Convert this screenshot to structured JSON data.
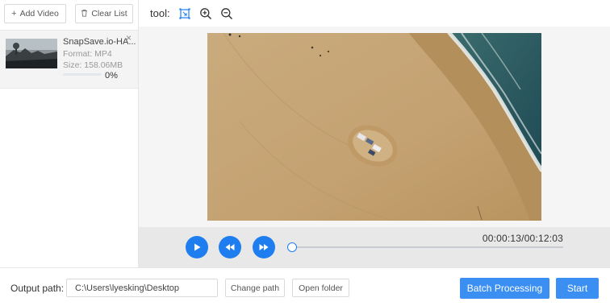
{
  "left_panel": {
    "add_video_label": "Add Video",
    "clear_list_label": "Clear List",
    "file": {
      "name": "SnapSave.io-HA...",
      "format": "Format:  MP4",
      "size": "Size:  158.06MB",
      "progress_text": "0%",
      "progress": 0
    }
  },
  "toolbar": {
    "label": "tool:",
    "icons": [
      "crop-icon",
      "zoom-in-icon",
      "zoom-out-icon"
    ]
  },
  "player": {
    "time": "00:00:13/00:12:03",
    "position_fraction": 0.018
  },
  "bottom": {
    "output_label": "Output path:",
    "output_path": "C:\\Users\\lyesking\\Desktop",
    "change_path_label": "Change path",
    "open_folder_label": "Open folder",
    "batch_label": "Batch Processing",
    "start_label": "Start"
  },
  "colors": {
    "accent": "#1e7ef0",
    "button_primary": "#3b8ff2",
    "sand": "#c9a777",
    "ocean": "#2a5d63"
  }
}
